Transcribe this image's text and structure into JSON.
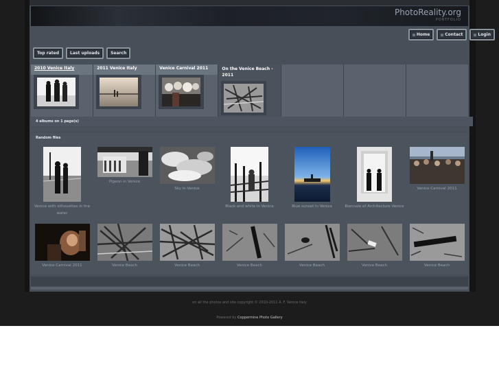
{
  "header": {
    "logo_title": "PhotoReality.org",
    "logo_subtitle": "PORTFOLIO"
  },
  "topnav": [
    {
      "label": "Home"
    },
    {
      "label": "Contact"
    },
    {
      "label": "Login"
    }
  ],
  "subnav": [
    {
      "label": "Top rated"
    },
    {
      "label": "Last uploads"
    },
    {
      "label": "Search"
    }
  ],
  "albums": [
    {
      "title": "2010 Venice Italy"
    },
    {
      "title": "2011 Venice Italy"
    },
    {
      "title": "Venice Carnival 2011"
    },
    {
      "title": "On the Venice Beach - 2011"
    }
  ],
  "album_count": "4 albums on 1 page(s)",
  "random": {
    "title": "Random files",
    "row1": [
      {
        "caption": "Venice with silhouettes in the water"
      },
      {
        "caption": "Pigeon in Venice"
      },
      {
        "caption": "Sky in Venice"
      },
      {
        "caption": "Black and white in Venice"
      },
      {
        "caption": "Blue sunset in Venice"
      },
      {
        "caption": "Biennale of Architecture Venice"
      },
      {
        "caption": "Venice Carnival 2011"
      }
    ],
    "row2": [
      {
        "caption": "Venice Carnival 2011"
      },
      {
        "caption": "Venice Beach"
      },
      {
        "caption": "Venice Beach"
      },
      {
        "caption": "Venice Beach"
      },
      {
        "caption": "Venice Beach"
      },
      {
        "caption": "Venice Beach"
      },
      {
        "caption": "Venice Beach"
      }
    ]
  },
  "footer": {
    "copyright": "on all the photos and site copyright © 2010-2011 A. F. Venice Italy",
    "powered_prefix": "Powered by",
    "powered_link": "Coppermine Photo Gallery"
  }
}
